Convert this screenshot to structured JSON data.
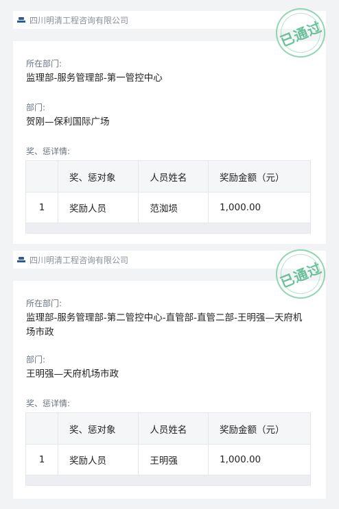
{
  "records": [
    {
      "company": "四川明清工程咨询有限公司",
      "stamp": "已通过",
      "dept_label": "所在部门:",
      "dept_value": "监理部-服务管理部-第一管控中心",
      "sub_dept_label": "部门:",
      "sub_dept_value": "贺刚—保利国际广场",
      "details_label": "奖、惩详情:",
      "table": {
        "headers": [
          "",
          "奖、惩对象",
          "人员姓名",
          "奖励金额（元）"
        ],
        "rows": [
          [
            "1",
            "奖励人员",
            "范洳埙",
            "1,000.00"
          ]
        ]
      }
    },
    {
      "company": "四川明清工程咨询有限公司",
      "stamp": "已通过",
      "dept_label": "所在部门:",
      "dept_value": "监理部-服务管理部-第二管控中心-直管部-直管二部-王明强—天府机场市政",
      "sub_dept_label": "部门:",
      "sub_dept_value": "王明强—天府机场市政",
      "details_label": "奖、惩详情:",
      "table": {
        "headers": [
          "",
          "奖、惩对象",
          "人员姓名",
          "奖励金额（元）"
        ],
        "rows": [
          [
            "1",
            "奖励人员",
            "王明强",
            "1,000.00"
          ]
        ]
      }
    }
  ]
}
